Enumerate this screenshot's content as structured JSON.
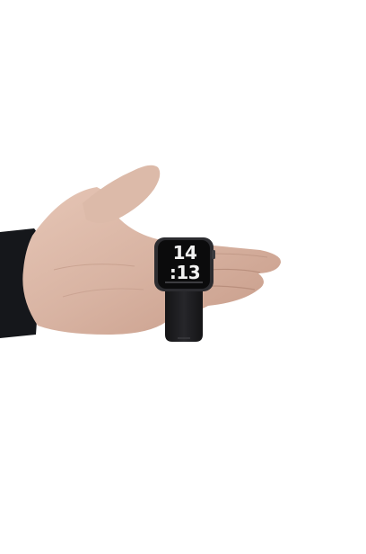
{
  "photo": {
    "subject": "hand-holding-smartwatch",
    "watch": {
      "time_hours": "14",
      "time_minutes": ":13"
    },
    "colors": {
      "background": "#ffffff",
      "skin": "#d9b6a6",
      "watch_band": "#1c1c1e",
      "sleeve": "#15171b"
    }
  }
}
